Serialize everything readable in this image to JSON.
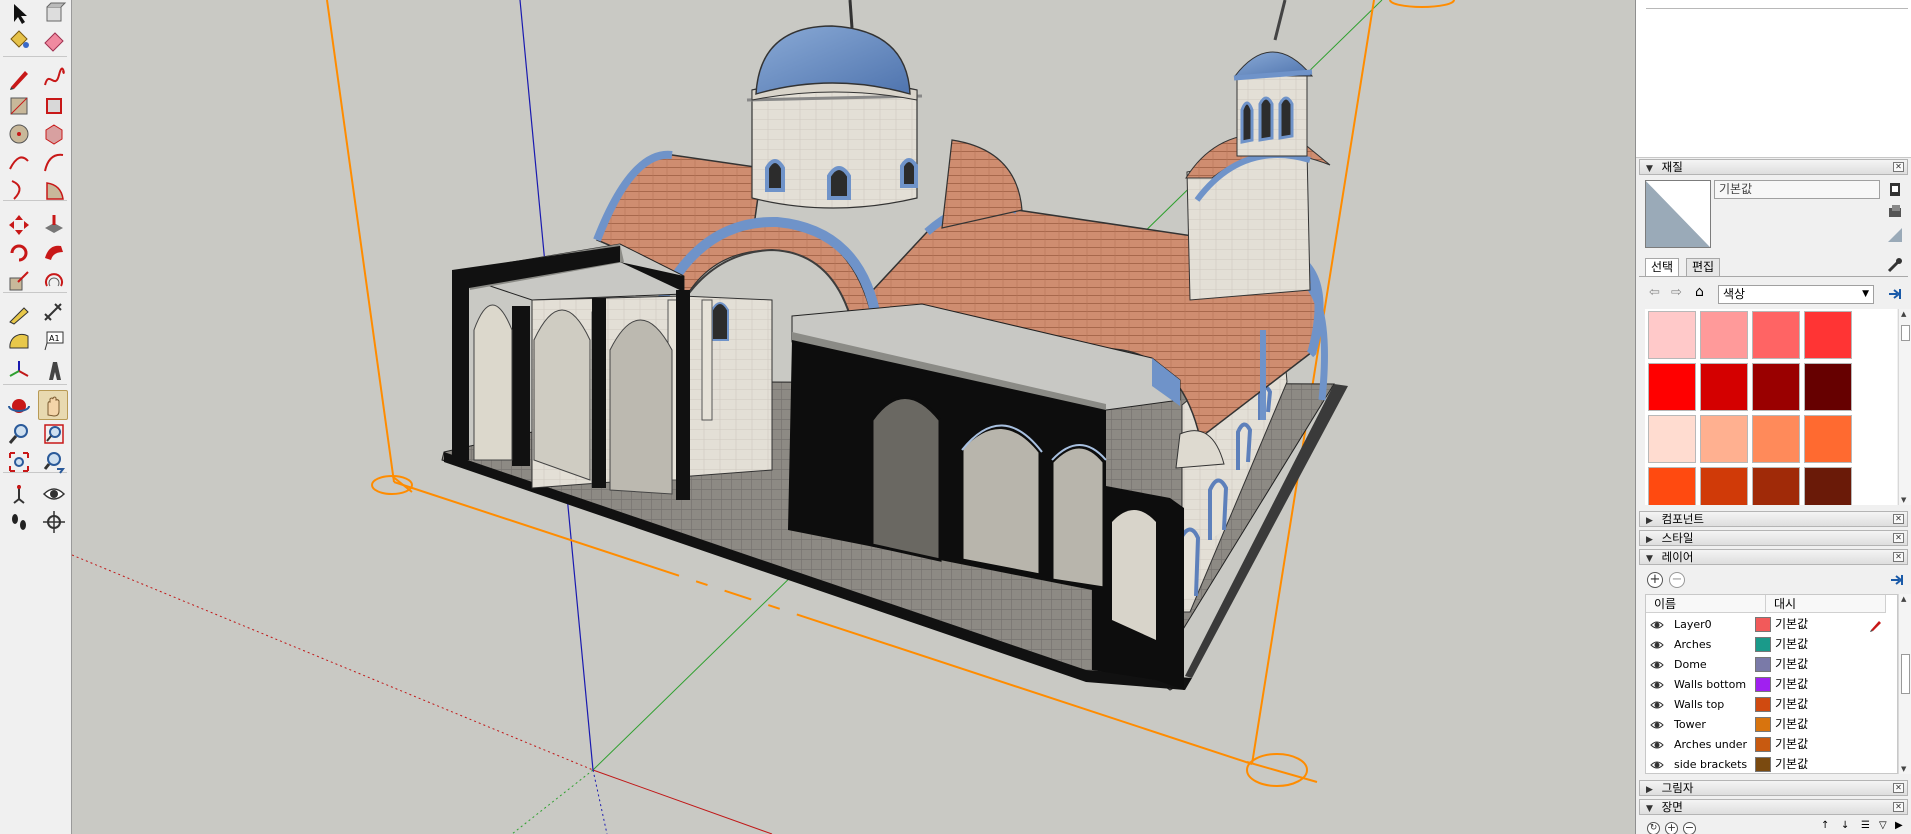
{
  "toolbar": {
    "tools": [
      {
        "name": "select",
        "icon": "select-arrow-icon"
      },
      {
        "name": "make-component",
        "icon": "component-icon"
      },
      {
        "name": "paint-bucket",
        "icon": "paint-bucket-icon"
      },
      {
        "name": "eraser",
        "icon": "eraser-icon"
      },
      {
        "name": "line",
        "icon": "pencil-icon"
      },
      {
        "name": "freehand",
        "icon": "freehand-icon"
      },
      {
        "name": "rectangle",
        "icon": "rectangle-icon"
      },
      {
        "name": "rotated-rectangle",
        "icon": "rotated-rectangle-icon"
      },
      {
        "name": "circle",
        "icon": "circle-icon"
      },
      {
        "name": "polygon",
        "icon": "polygon-icon"
      },
      {
        "name": "arc",
        "icon": "arc-icon"
      },
      {
        "name": "2-point-arc",
        "icon": "two-point-arc-icon"
      },
      {
        "name": "3-point-arc",
        "icon": "three-point-arc-icon"
      },
      {
        "name": "pie",
        "icon": "pie-icon"
      },
      {
        "name": "move",
        "icon": "move-icon"
      },
      {
        "name": "push-pull",
        "icon": "push-pull-icon"
      },
      {
        "name": "rotate",
        "icon": "rotate-icon"
      },
      {
        "name": "follow-me",
        "icon": "follow-me-icon"
      },
      {
        "name": "scale",
        "icon": "scale-icon"
      },
      {
        "name": "offset",
        "icon": "offset-icon"
      },
      {
        "name": "tape-measure",
        "icon": "tape-measure-icon"
      },
      {
        "name": "dimension",
        "icon": "dimension-icon"
      },
      {
        "name": "protractor",
        "icon": "protractor-icon"
      },
      {
        "name": "text",
        "icon": "text-icon",
        "glyph": "A1"
      },
      {
        "name": "axes",
        "icon": "axes-icon"
      },
      {
        "name": "3d-text",
        "icon": "3d-text-icon"
      },
      {
        "name": "orbit",
        "icon": "orbit-icon"
      },
      {
        "name": "pan",
        "icon": "pan-hand-icon"
      },
      {
        "name": "zoom",
        "icon": "zoom-icon"
      },
      {
        "name": "zoom-window",
        "icon": "zoom-window-icon"
      },
      {
        "name": "zoom-extents",
        "icon": "zoom-extents-icon"
      },
      {
        "name": "previous",
        "icon": "previous-view-icon"
      },
      {
        "name": "position-camera",
        "icon": "position-camera-icon"
      },
      {
        "name": "look-around",
        "icon": "look-around-eye-icon"
      },
      {
        "name": "walk",
        "icon": "walk-footprints-icon"
      },
      {
        "name": "section-plane",
        "icon": "section-plane-icon"
      }
    ],
    "active_tool": "pan"
  },
  "tray": {
    "materials": {
      "title": "재질",
      "name_value": "기본값",
      "tabs": [
        "선택",
        "편집"
      ],
      "library": "색상",
      "swatches": [
        "#ffc9c9",
        "#ff9a9a",
        "#ff6464",
        "#ff3434",
        "#ff0000",
        "#d40000",
        "#9a0000",
        "#660000",
        "#ffdcd0",
        "#ffb090",
        "#ff8a5a",
        "#ff6a30",
        "#ff4a10",
        "#d03a08",
        "#a02a08",
        "#6a1a08"
      ]
    },
    "components": {
      "title": "컴포넌트"
    },
    "styles": {
      "title": "스타일"
    },
    "layers": {
      "title": "레이어",
      "col_name": "이름",
      "col_dash": "대시",
      "rows": [
        {
          "name": "Layer0",
          "color": "#f25a5a",
          "dash": "기본값",
          "current": true
        },
        {
          "name": "Arches",
          "color": "#1a9a8a",
          "dash": "기본값"
        },
        {
          "name": "Dome",
          "color": "#7a7aa8",
          "dash": "기본값"
        },
        {
          "name": "Walls bottom",
          "color": "#a020f0",
          "dash": "기본값"
        },
        {
          "name": "Walls top",
          "color": "#d04a10",
          "dash": "기본값"
        },
        {
          "name": "Tower",
          "color": "#d8740e",
          "dash": "기본값"
        },
        {
          "name": "Arches under",
          "color": "#c85a10",
          "dash": "기본값"
        },
        {
          "name": "side brackets",
          "color": "#7a4a10",
          "dash": "기본값"
        }
      ]
    },
    "shadows": {
      "title": "그림자"
    },
    "scenes": {
      "title": "장면"
    }
  },
  "colors": {
    "viewport_bg": "#c9c9c4",
    "axis_red": "#c01818",
    "axis_green": "#2fa02f",
    "axis_blue": "#1a1ab0",
    "section_orange": "#ff8c00",
    "dome_blue": "#6f93c9",
    "roof_tile": "#cf8d70",
    "wall_stone": "#e0dcd2"
  }
}
